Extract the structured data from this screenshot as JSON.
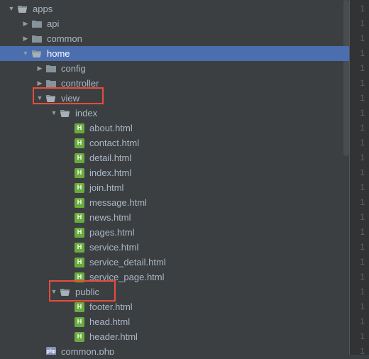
{
  "tree": {
    "items": [
      {
        "depth": 0,
        "expanded": true,
        "type": "folder-open",
        "label": "apps"
      },
      {
        "depth": 1,
        "expanded": false,
        "type": "folder",
        "label": "api"
      },
      {
        "depth": 1,
        "expanded": false,
        "type": "folder",
        "label": "common"
      },
      {
        "depth": 1,
        "expanded": true,
        "type": "folder-open",
        "label": "home",
        "selected": true
      },
      {
        "depth": 2,
        "expanded": false,
        "type": "folder",
        "label": "config"
      },
      {
        "depth": 2,
        "expanded": false,
        "type": "folder",
        "label": "controller"
      },
      {
        "depth": 2,
        "expanded": true,
        "type": "folder-open",
        "label": "view"
      },
      {
        "depth": 3,
        "expanded": true,
        "type": "folder-open",
        "label": "index"
      },
      {
        "depth": 4,
        "expanded": null,
        "type": "html",
        "label": "about.html"
      },
      {
        "depth": 4,
        "expanded": null,
        "type": "html",
        "label": "contact.html"
      },
      {
        "depth": 4,
        "expanded": null,
        "type": "html",
        "label": "detail.html"
      },
      {
        "depth": 4,
        "expanded": null,
        "type": "html",
        "label": "index.html"
      },
      {
        "depth": 4,
        "expanded": null,
        "type": "html",
        "label": "join.html"
      },
      {
        "depth": 4,
        "expanded": null,
        "type": "html",
        "label": "message.html"
      },
      {
        "depth": 4,
        "expanded": null,
        "type": "html",
        "label": "news.html"
      },
      {
        "depth": 4,
        "expanded": null,
        "type": "html",
        "label": "pages.html"
      },
      {
        "depth": 4,
        "expanded": null,
        "type": "html",
        "label": "service.html"
      },
      {
        "depth": 4,
        "expanded": null,
        "type": "html",
        "label": "service_detail.html"
      },
      {
        "depth": 4,
        "expanded": null,
        "type": "html",
        "label": "service_page.html"
      },
      {
        "depth": 3,
        "expanded": true,
        "type": "folder-open",
        "label": "public"
      },
      {
        "depth": 4,
        "expanded": null,
        "type": "html",
        "label": "footer.html"
      },
      {
        "depth": 4,
        "expanded": null,
        "type": "html",
        "label": "head.html"
      },
      {
        "depth": 4,
        "expanded": null,
        "type": "html",
        "label": "header.html"
      },
      {
        "depth": 2,
        "expanded": null,
        "type": "php",
        "label": "common.php"
      }
    ]
  },
  "gutter": {
    "lines": [
      "1",
      "1",
      "1",
      "1",
      "1",
      "1",
      "1",
      "1",
      "1",
      "1",
      "1",
      "1",
      "1",
      "1",
      "1",
      "1",
      "1",
      "1",
      "1",
      "1",
      "1",
      "1",
      "1",
      "1"
    ]
  }
}
